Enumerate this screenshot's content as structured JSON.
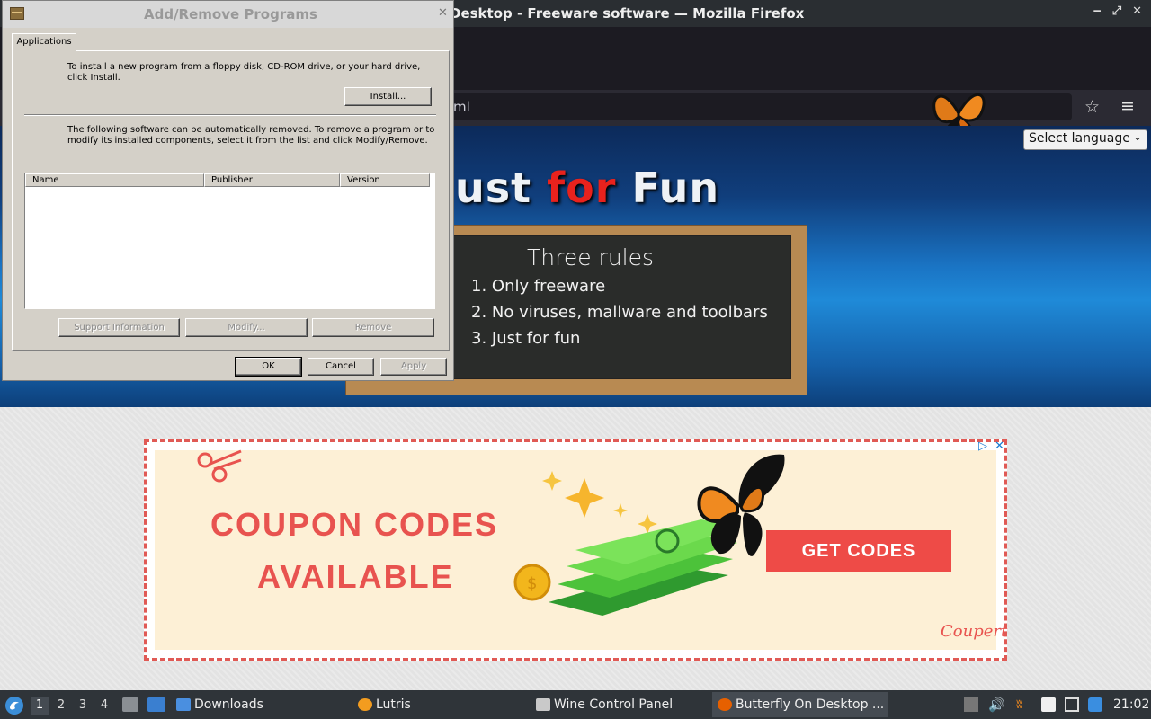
{
  "firefox": {
    "title": "Desktop - Freeware software — Mozilla Firefox",
    "url_fragment": "ml",
    "controls": [
      "‒",
      "⤢",
      "✕"
    ]
  },
  "page": {
    "hero_title_a": "ust ",
    "hero_title_b": "for",
    "hero_title_c": " Fun",
    "language_select": "Select language",
    "chalkboard": {
      "title": "Three rules",
      "rules": [
        "1. Only freeware",
        "2. No viruses, mallware and toolbars",
        "3. Just for fun"
      ]
    },
    "ad": {
      "line1": "COUPON CODES",
      "line2": "AVAILABLE",
      "cta": "GET CODES",
      "brand": "Coupert"
    }
  },
  "dialog": {
    "title": "Add/Remove Programs",
    "tab": "Applications",
    "install_text": "To install a new program from a floppy disk, CD-ROM drive, or your hard drive, click Install.",
    "install_button": "Install...",
    "remove_text": "The following software can be automatically removed. To remove a program or to modify its installed components, select it from the list and click Modify/Remove.",
    "columns": [
      "Name",
      "Publisher",
      "Version"
    ],
    "support_button": "Support Information",
    "modify_button": "Modify...",
    "remove_button": "Remove",
    "ok_button": "OK",
    "cancel_button": "Cancel",
    "apply_button": "Apply"
  },
  "taskbar": {
    "workspaces": [
      "1",
      "2",
      "3",
      "4"
    ],
    "downloads": "Downloads",
    "lutris": "Lutris",
    "wine_control_panel": "Wine Control Panel",
    "firefox_task": "Butterfly On Desktop ...",
    "clock": "21:02"
  },
  "colors": {
    "accent_red": "#e8534f",
    "hero_blue": "#1a74c4",
    "taskbar": "#2f3439"
  }
}
